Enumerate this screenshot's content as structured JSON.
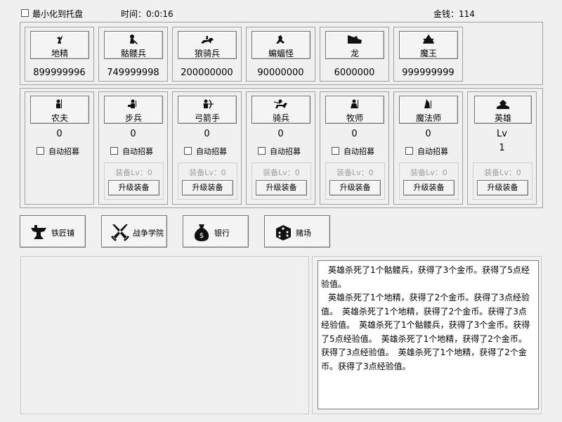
{
  "topbar": {
    "minimize_label": "最小化到托盘",
    "time_label": "时间：0:0:16",
    "money_label": "金钱：114"
  },
  "enemies": [
    {
      "label": "地精",
      "count": "899999996",
      "icon": "goblin-icon"
    },
    {
      "label": "骷髅兵",
      "count": "749999998",
      "icon": "skeleton-icon"
    },
    {
      "label": "狼骑兵",
      "count": "200000000",
      "icon": "wolf-rider-icon"
    },
    {
      "label": "蝙蝠怪",
      "count": "90000000",
      "icon": "bat-icon"
    },
    {
      "label": "龙",
      "count": "6000000",
      "icon": "dragon-icon"
    },
    {
      "label": "魔王",
      "count": "999999999",
      "icon": "demon-king-icon"
    }
  ],
  "units": [
    {
      "label": "农夫",
      "count": "0",
      "icon": "farmer-icon",
      "auto": "自动招募",
      "equip": null
    },
    {
      "label": "步兵",
      "count": "0",
      "icon": "infantry-icon",
      "auto": "自动招募",
      "equip": {
        "level": "装备Lv：0",
        "upgrade": "升级装备"
      }
    },
    {
      "label": "弓箭手",
      "count": "0",
      "icon": "archer-icon",
      "auto": "自动招募",
      "equip": {
        "level": "装备Lv：0",
        "upgrade": "升级装备"
      }
    },
    {
      "label": "骑兵",
      "count": "0",
      "icon": "cavalry-icon",
      "auto": "自动招募",
      "equip": {
        "level": "装备Lv：0",
        "upgrade": "升级装备"
      }
    },
    {
      "label": "牧师",
      "count": "0",
      "icon": "priest-icon",
      "auto": "自动招募",
      "equip": {
        "level": "装备Lv：0",
        "upgrade": "升级装备"
      }
    },
    {
      "label": "魔法师",
      "count": "0",
      "icon": "mage-icon",
      "auto": "自动招募",
      "equip": {
        "level": "装备Lv：0",
        "upgrade": "升级装备"
      }
    }
  ],
  "hero": {
    "label": "英雄",
    "lv_label": "Lv",
    "lv": "1",
    "icon": "hero-icon",
    "equip": {
      "level": "装备Lv：0",
      "upgrade": "升级装备"
    }
  },
  "buildings": [
    {
      "label": "铁匠铺",
      "icon": "anvil-icon"
    },
    {
      "label": "战争学院",
      "icon": "crossed-swords-icon"
    },
    {
      "label": "银行",
      "icon": "money-bag-icon"
    },
    {
      "label": "赌场",
      "icon": "dice-icon"
    }
  ],
  "log": [
    "英雄杀死了1个骷髅兵，获得了3个金币。获得了5点经验值。",
    "英雄杀死了1个地精，获得了2个金币。获得了3点经验值。　英雄杀死了1个地精，获得了2个金币。获得了3点经验值。　英雄杀死了1个骷髅兵，获得了3个金币。获得了5点经验值。　英雄杀死了1个地精，获得了2个金币。获得了3点经验值。　英雄杀死了1个地精，获得了2个金币。获得了3点经验值。"
  ]
}
